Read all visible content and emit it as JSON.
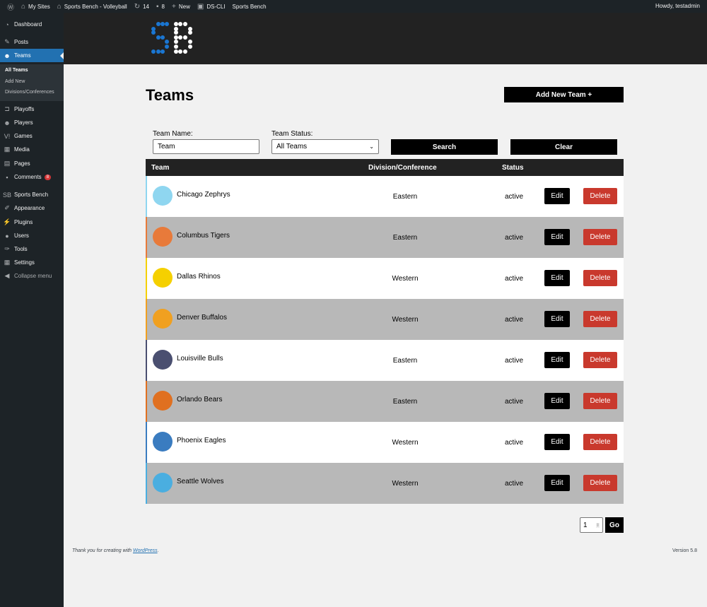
{
  "adminbar": {
    "items": [
      {
        "icon": "wordpress-icon",
        "label": ""
      },
      {
        "icon": "my-sites-icon",
        "label": "My Sites"
      },
      {
        "icon": "home-icon",
        "label": "Sports Bench - Volleyball"
      },
      {
        "icon": "updates-icon",
        "label": "14"
      },
      {
        "icon": "comment-icon",
        "label": "8"
      },
      {
        "icon": "plus-icon",
        "label": "New"
      },
      {
        "icon": "terminal-icon",
        "label": "DS-CLI"
      },
      {
        "icon": "",
        "label": "Sports Bench"
      }
    ],
    "howdy": "Howdy, testadmin"
  },
  "sidebar": {
    "items": [
      {
        "label": "Dashboard",
        "icon": "dashboard-icon"
      },
      {
        "label": "Posts",
        "icon": "pin-icon"
      },
      {
        "label": "Teams",
        "icon": "groups-icon",
        "active": true
      },
      {
        "label": "Playoffs",
        "icon": "bracket-icon"
      },
      {
        "label": "Players",
        "icon": "groups-icon"
      },
      {
        "label": "Games",
        "icon": "vs-icon"
      },
      {
        "label": "Media",
        "icon": "media-icon"
      },
      {
        "label": "Pages",
        "icon": "pages-icon"
      },
      {
        "label": "Comments",
        "icon": "comment-icon",
        "badge": "8"
      },
      {
        "label": "Sports Bench",
        "icon": "sb-icon"
      },
      {
        "label": "Appearance",
        "icon": "brush-icon"
      },
      {
        "label": "Plugins",
        "icon": "plugin-icon"
      },
      {
        "label": "Users",
        "icon": "user-icon"
      },
      {
        "label": "Tools",
        "icon": "wrench-icon"
      },
      {
        "label": "Settings",
        "icon": "settings-icon"
      },
      {
        "label": "Collapse menu",
        "icon": "collapse-icon"
      }
    ],
    "submenu": [
      "All Teams",
      "Add New",
      "Divisions/Conferences"
    ]
  },
  "brand": {
    "logo_text": "SB",
    "colors": {
      "s": "#1a76d2",
      "b": "#ffffff"
    }
  },
  "page": {
    "title": "Teams",
    "add_button": "Add New Team +"
  },
  "filters": {
    "name_label": "Team Name:",
    "name_value": "Team",
    "status_label": "Team Status:",
    "status_value": "All Teams",
    "search": "Search",
    "clear": "Clear"
  },
  "table": {
    "headers": [
      "Team",
      "Division/Conference",
      "Status"
    ],
    "edit": "Edit",
    "delete": "Delete",
    "delete_color": "#c9392d",
    "rows": [
      {
        "team": "Chicago Zephrys",
        "division": "Eastern",
        "status": "active",
        "color": "#8fd6f0"
      },
      {
        "team": "Columbus Tigers",
        "division": "Eastern",
        "status": "active",
        "color": "#e87a3a"
      },
      {
        "team": "Dallas Rhinos",
        "division": "Western",
        "status": "active",
        "color": "#f5d000"
      },
      {
        "team": "Denver Buffalos",
        "division": "Western",
        "status": "active",
        "color": "#f0a020"
      },
      {
        "team": "Louisville Bulls",
        "division": "Eastern",
        "status": "active",
        "color": "#4a4f70"
      },
      {
        "team": "Orlando Bears",
        "division": "Eastern",
        "status": "active",
        "color": "#e07020"
      },
      {
        "team": "Phoenix Eagles",
        "division": "Western",
        "status": "active",
        "color": "#3a7cc0"
      },
      {
        "team": "Seattle Wolves",
        "division": "Western",
        "status": "active",
        "color": "#4aaee0"
      }
    ]
  },
  "pagination": {
    "page": "1",
    "go": "Go"
  },
  "footer": {
    "text": "Thank you for creating with ",
    "link": "WordPress",
    "suffix": ".",
    "version": "Version 5.8"
  }
}
